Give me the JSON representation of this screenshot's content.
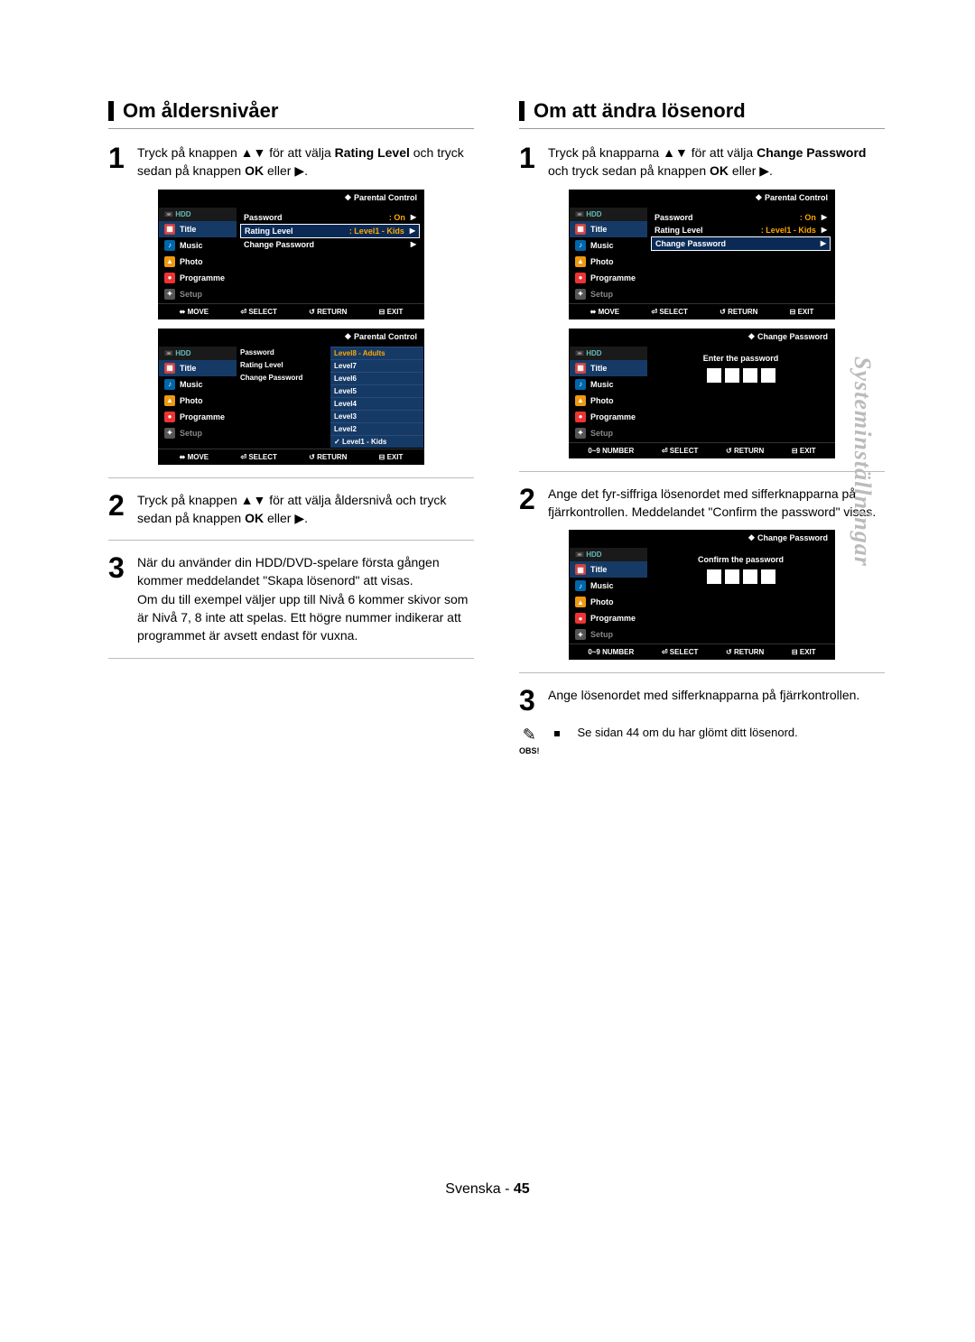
{
  "headings": {
    "left": "Om åldersnivåer",
    "right": "Om att ändra lösenord"
  },
  "left_steps": {
    "s1": "Tryck på knappen ▲▼ för att välja <b>Rating Level</b> och tryck sedan på knappen <b>OK</b> eller ▶.",
    "s2": "Tryck på knappen ▲▼ för att välja åldersnivå och tryck sedan på knappen <b>OK</b> eller ▶.",
    "s3": "När du använder din HDD/DVD-spelare första gången kommer meddelandet \"Skapa lösenord\" att visas.<br>Om du till exempel väljer upp till Nivå 6 kommer skivor som är Nivå 7, 8 inte att spelas. Ett högre nummer indikerar att programmet är avsett endast för vuxna."
  },
  "right_steps": {
    "s1": "Tryck på knapparna ▲▼ för att välja <b>Change Password</b> och tryck sedan på knappen <b>OK</b> eller ▶.",
    "s2": "Ange det fyr-siffriga lösenordet med sifferknapparna på fjärrkontrollen. Meddelandet \"Confirm the password\" visas.",
    "s3": "Ange lösenordet med sifferknapparna på fjärrkontrollen."
  },
  "note": {
    "label": "OBS!",
    "text": "Se sidan 44 om du har glömt ditt lösenord."
  },
  "screens": {
    "parental_title": "Parental Control",
    "change_pw_title": "Change Password",
    "nav": {
      "hdd": "HDD",
      "title": "Title",
      "music": "Music",
      "photo": "Photo",
      "programme": "Programme",
      "setup": "Setup"
    },
    "rows": {
      "password": "Password",
      "on": ": On",
      "rating": "Rating Level",
      "level1": ": Level1 - Kids",
      "change": "Change Password"
    },
    "levels": [
      "Level8 - Adults",
      "Level7",
      "Level6",
      "Level5",
      "Level4",
      "Level3",
      "Level2",
      "Level1 - Kids"
    ],
    "prompts": {
      "enter": "Enter the password",
      "confirm": "Confirm the password"
    },
    "footer_move": "MOVE",
    "footer_num": "0~9 NUMBER",
    "footer_select": "SELECT",
    "footer_return": "RETURN",
    "footer_exit": "EXIT"
  },
  "side_tab": "Systeminställningar",
  "footer": {
    "lang": "Svenska",
    "page": "45"
  }
}
